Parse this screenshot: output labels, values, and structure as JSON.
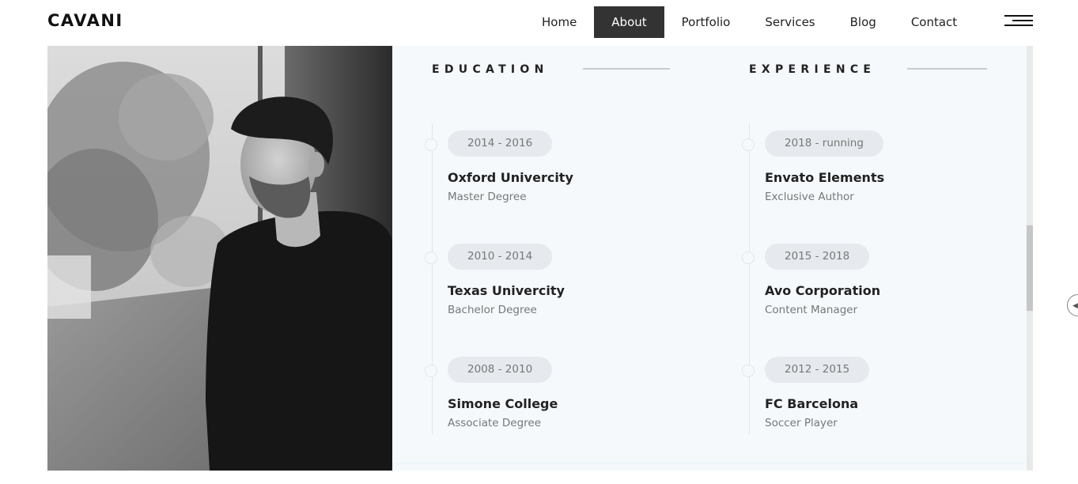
{
  "brand": {
    "logo_text": "CAVANI"
  },
  "nav": {
    "items": [
      {
        "label": "Home",
        "active": false
      },
      {
        "label": "About",
        "active": true
      },
      {
        "label": "Portfolio",
        "active": false
      },
      {
        "label": "Services",
        "active": false
      },
      {
        "label": "Blog",
        "active": false
      },
      {
        "label": "Contact",
        "active": false
      }
    ],
    "menu_icon": "hamburger-menu-icon"
  },
  "photo": {
    "icon": "portrait-photo"
  },
  "resume": {
    "education": {
      "title": "EDUCATION",
      "items": [
        {
          "years": "2014 - 2016",
          "title": "Oxford Univercity",
          "subtitle": "Master Degree"
        },
        {
          "years": "2010 - 2014",
          "title": "Texas Univercity",
          "subtitle": "Bachelor Degree"
        },
        {
          "years": "2008 - 2010",
          "title": "Simone College",
          "subtitle": "Associate Degree"
        }
      ]
    },
    "experience": {
      "title": "EXPERIENCE",
      "items": [
        {
          "years": "2018 - running",
          "title": "Envato Elements",
          "subtitle": "Exclusive Author"
        },
        {
          "years": "2015 - 2018",
          "title": "Avo Corporation",
          "subtitle": "Content Manager"
        },
        {
          "years": "2012 - 2015",
          "title": "FC Barcelona",
          "subtitle": "Soccer Player"
        }
      ]
    }
  },
  "side_control": {
    "icon": "chevron-left-icon"
  },
  "colors": {
    "active_nav_bg": "#333333",
    "panel_bg": "#f5f9fc",
    "badge_bg": "#e6eaee",
    "title_text": "#222222",
    "muted_text": "#777777"
  }
}
